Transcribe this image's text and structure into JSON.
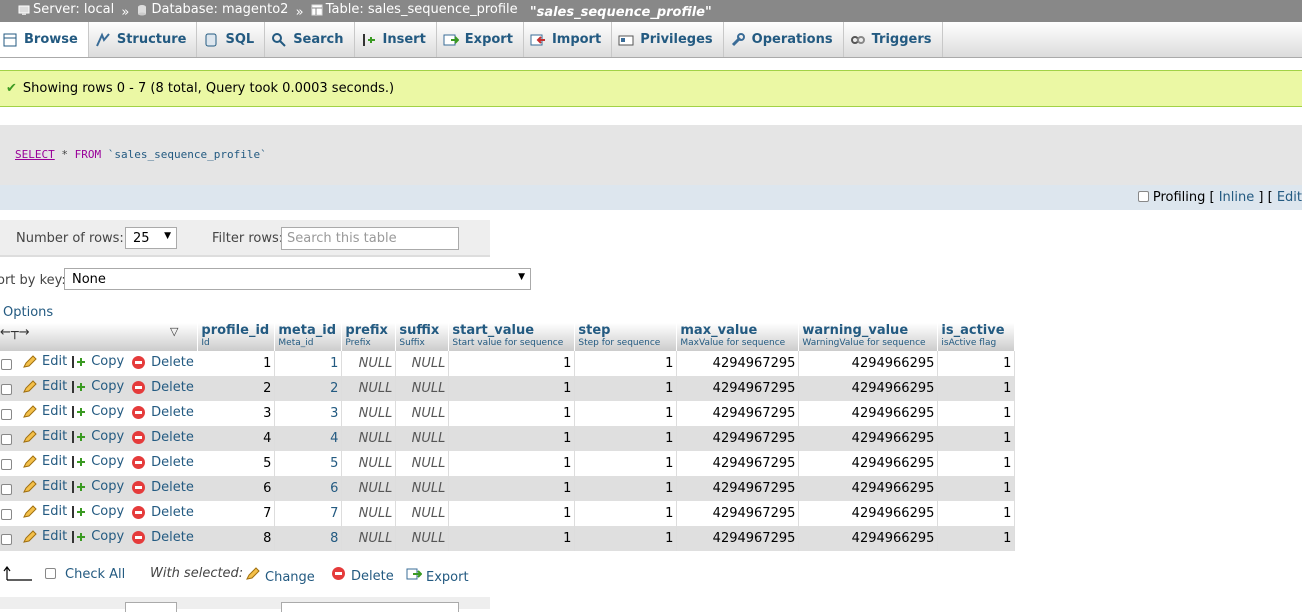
{
  "breadcrumb": {
    "server": "Server: local",
    "database": "Database: magento2",
    "table": "Table: sales_sequence_profile",
    "table_quoted": "\"sales_sequence_profile\"",
    "separator": "»"
  },
  "tabs": [
    {
      "label": "Browse",
      "icon": "browse-icon",
      "active": true
    },
    {
      "label": "Structure",
      "icon": "structure-icon"
    },
    {
      "label": "SQL",
      "icon": "sql-icon"
    },
    {
      "label": "Search",
      "icon": "search-icon"
    },
    {
      "label": "Insert",
      "icon": "insert-icon"
    },
    {
      "label": "Export",
      "icon": "export-icon"
    },
    {
      "label": "Import",
      "icon": "import-icon"
    },
    {
      "label": "Privileges",
      "icon": "privileges-icon"
    },
    {
      "label": "Operations",
      "icon": "wrench-icon"
    },
    {
      "label": "Triggers",
      "icon": "triggers-icon"
    }
  ],
  "success": {
    "message": "Showing rows 0 - 7 (8 total, Query took 0.0003 seconds.)"
  },
  "sql": {
    "select": "SELECT",
    "star": "*",
    "from": "FROM",
    "table": "`sales_sequence_profile`"
  },
  "profiling": {
    "label": "Profiling [",
    "inline": "Inline",
    "mid": "] [",
    "edit": "Edit"
  },
  "nav": {
    "rows_label": "Number of rows:",
    "rows_value": "25",
    "filter_label": "Filter rows:",
    "filter_placeholder": "Search this table"
  },
  "sort": {
    "label": "ort by key:",
    "value": "None"
  },
  "options_label": "Options",
  "columns": [
    {
      "name": "profile_id",
      "comment": "Id"
    },
    {
      "name": "meta_id",
      "comment": "Meta_id"
    },
    {
      "name": "prefix",
      "comment": "Prefix"
    },
    {
      "name": "suffix",
      "comment": "Suffix"
    },
    {
      "name": "start_value",
      "comment": "Start value for sequence"
    },
    {
      "name": "step",
      "comment": "Step for sequence"
    },
    {
      "name": "max_value",
      "comment": "MaxValue for sequence"
    },
    {
      "name": "warning_value",
      "comment": "WarningValue for sequence"
    },
    {
      "name": "is_active",
      "comment": "isActive flag"
    }
  ],
  "actions": {
    "edit": "Edit",
    "copy": "Copy",
    "delete": "Delete"
  },
  "rows": [
    [
      "1",
      "1",
      "NULL",
      "NULL",
      "1",
      "1",
      "4294967295",
      "4294966295",
      "1"
    ],
    [
      "2",
      "2",
      "NULL",
      "NULL",
      "1",
      "1",
      "4294967295",
      "4294966295",
      "1"
    ],
    [
      "3",
      "3",
      "NULL",
      "NULL",
      "1",
      "1",
      "4294967295",
      "4294966295",
      "1"
    ],
    [
      "4",
      "4",
      "NULL",
      "NULL",
      "1",
      "1",
      "4294967295",
      "4294966295",
      "1"
    ],
    [
      "5",
      "5",
      "NULL",
      "NULL",
      "1",
      "1",
      "4294967295",
      "4294966295",
      "1"
    ],
    [
      "6",
      "6",
      "NULL",
      "NULL",
      "1",
      "1",
      "4294967295",
      "4294966295",
      "1"
    ],
    [
      "7",
      "7",
      "NULL",
      "NULL",
      "1",
      "1",
      "4294967295",
      "4294966295",
      "1"
    ],
    [
      "8",
      "8",
      "NULL",
      "NULL",
      "1",
      "1",
      "4294967295",
      "4294966295",
      "1"
    ]
  ],
  "bottom": {
    "check_all": "Check All",
    "with_selected": "With selected:",
    "change": "Change",
    "delete": "Delete",
    "export": "Export"
  },
  "colors": {
    "link": "#235a81",
    "success_bg": "#ebf8a4",
    "delete": "#e53b3b"
  }
}
